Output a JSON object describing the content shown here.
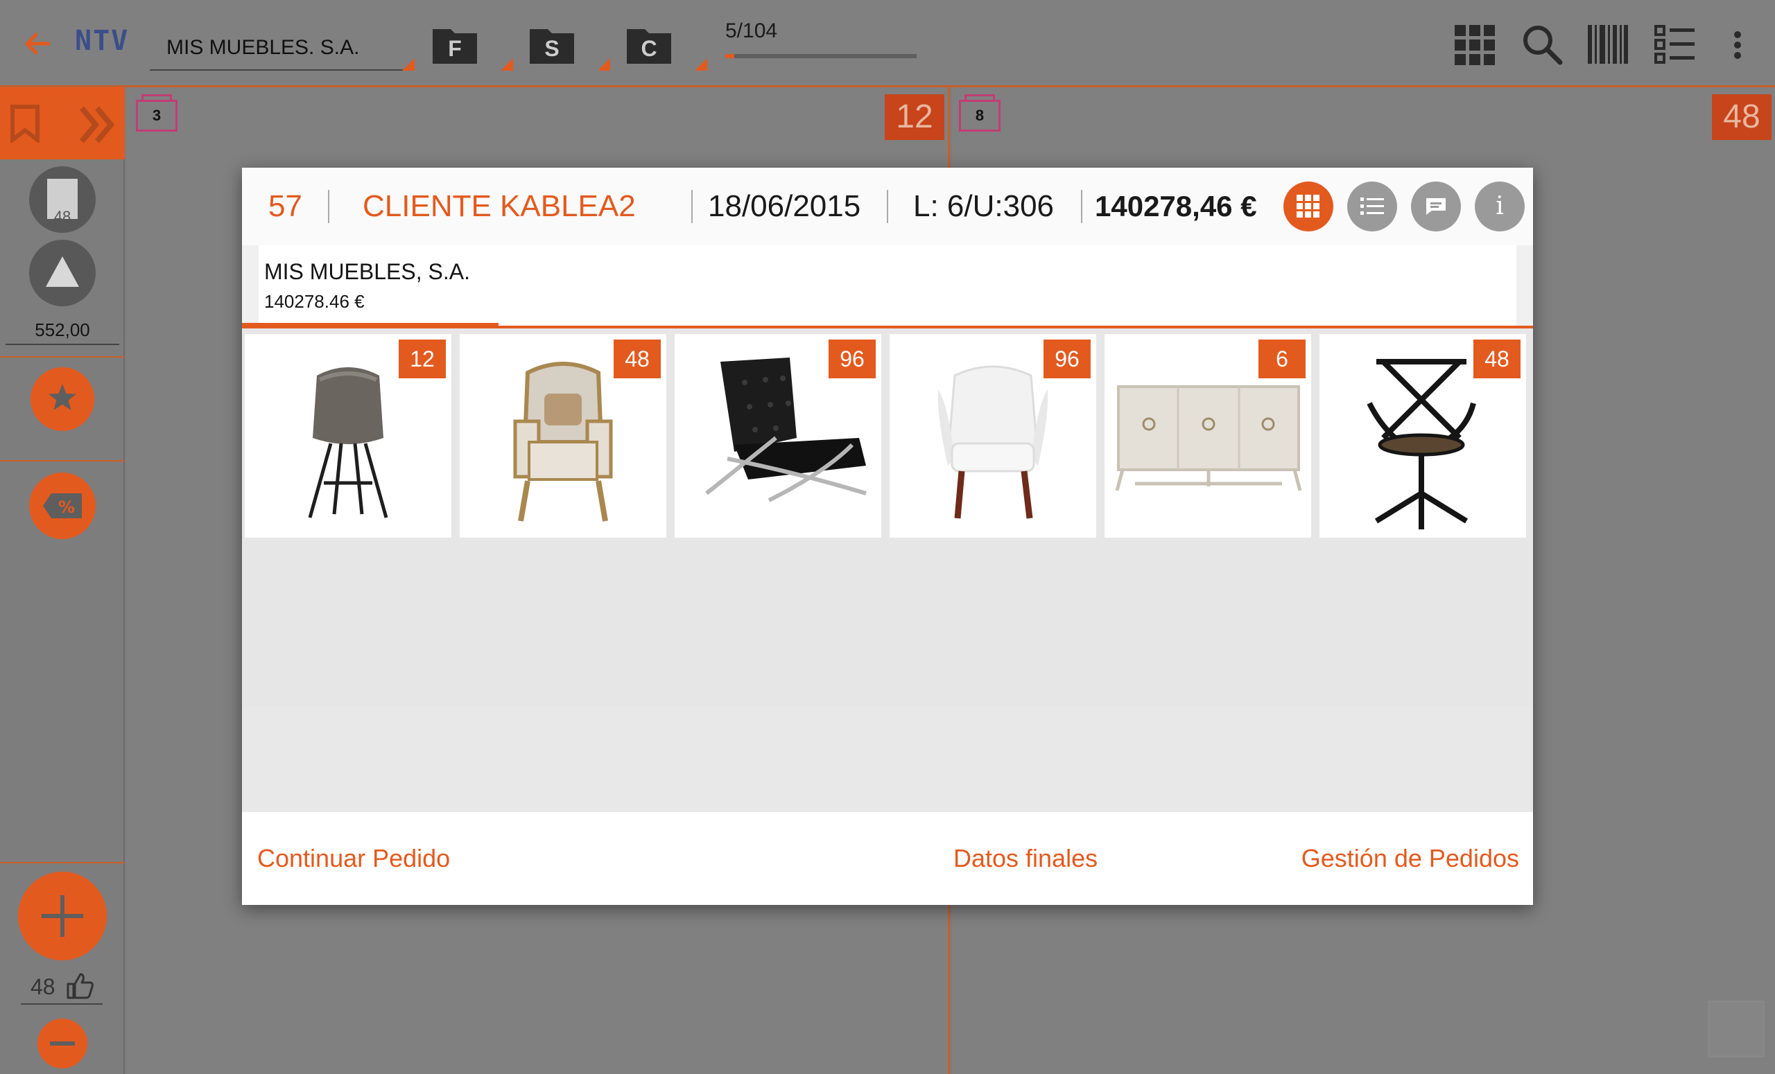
{
  "toolbar": {
    "logo": "NTV",
    "client": "MIS MUEBLES. S.A.",
    "folders": [
      "F",
      "S",
      "C"
    ],
    "page_counter": "5/104",
    "page_progress": 0.048,
    "icons": [
      "back-arrow-icon",
      "grid-icon",
      "search-icon",
      "barcode-icon",
      "list-icon",
      "more-vert-icon"
    ]
  },
  "sidebar": {
    "cart_count": "48",
    "price": "552,00",
    "liked_count": "48",
    "icons": [
      "bookmark-icon",
      "double-chevron-icon",
      "cart-icon",
      "triangle-icon",
      "star-icon",
      "discount-tag-icon",
      "plus-icon",
      "thumbs-up-icon",
      "minus-icon"
    ]
  },
  "catalog": {
    "left_page": {
      "tag": "3",
      "badge": "12"
    },
    "right_page": {
      "tag": "8",
      "badge": "48"
    }
  },
  "order": {
    "number": "57",
    "client": "CLIENTE KABLEA2",
    "date": "18/06/2015",
    "lines_units": "L: 6/U:306",
    "total": "140278,46 €",
    "company": "MIS MUEBLES, S.A.",
    "company_total": "140278.46 €",
    "items": [
      {
        "product": "chair-eames",
        "qty": "12"
      },
      {
        "product": "armchair-classic",
        "qty": "48"
      },
      {
        "product": "armchair-barcelona",
        "qty": "96"
      },
      {
        "product": "armchair-white",
        "qty": "96"
      },
      {
        "product": "sideboard",
        "qty": "6"
      },
      {
        "product": "swivel-chair",
        "qty": "48"
      }
    ],
    "actions": {
      "continue": "Continuar Pedido",
      "final_data": "Datos finales",
      "manage": "Gestión de Pedidos"
    }
  },
  "colors": {
    "accent": "#e35a1e",
    "grey": "#808080"
  }
}
